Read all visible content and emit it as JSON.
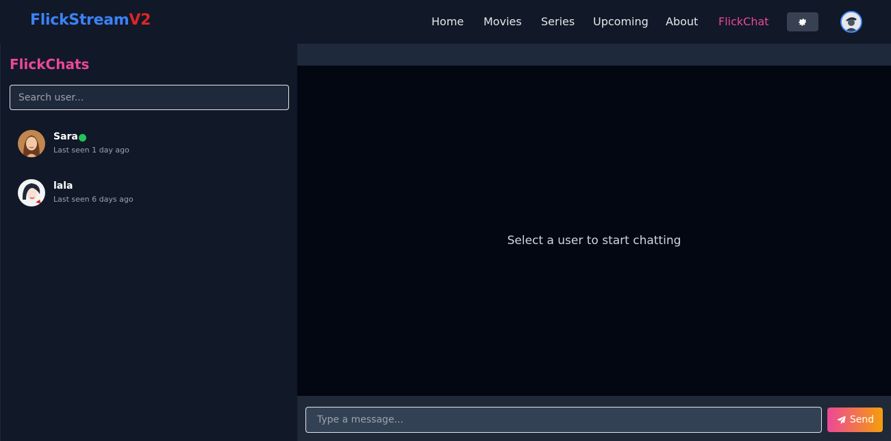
{
  "header": {
    "logo_main": "FlickStream",
    "logo_suffix": "V2",
    "nav": [
      "Home",
      "Movies",
      "Series",
      "Upcoming",
      "About",
      "FlickChat"
    ],
    "active_nav": "FlickChat"
  },
  "sidebar": {
    "title": "FlickChats",
    "search_placeholder": "Search user...",
    "users": [
      {
        "name": "Sara",
        "last_seen": "Last seen 1 day ago",
        "online": true
      },
      {
        "name": "lala",
        "last_seen": "Last seen 6 days ago",
        "online": false
      }
    ]
  },
  "chat": {
    "empty_message": "Select a user to start chatting",
    "message_placeholder": "Type a message...",
    "send_label": "Send"
  },
  "colors": {
    "accent": "#ec4899",
    "brand": "#3b82f6",
    "brand_suffix": "#dc2626",
    "online": "#22c55e"
  },
  "icons": [
    "gear-icon",
    "paper-plane-icon",
    "user-avatar"
  ]
}
